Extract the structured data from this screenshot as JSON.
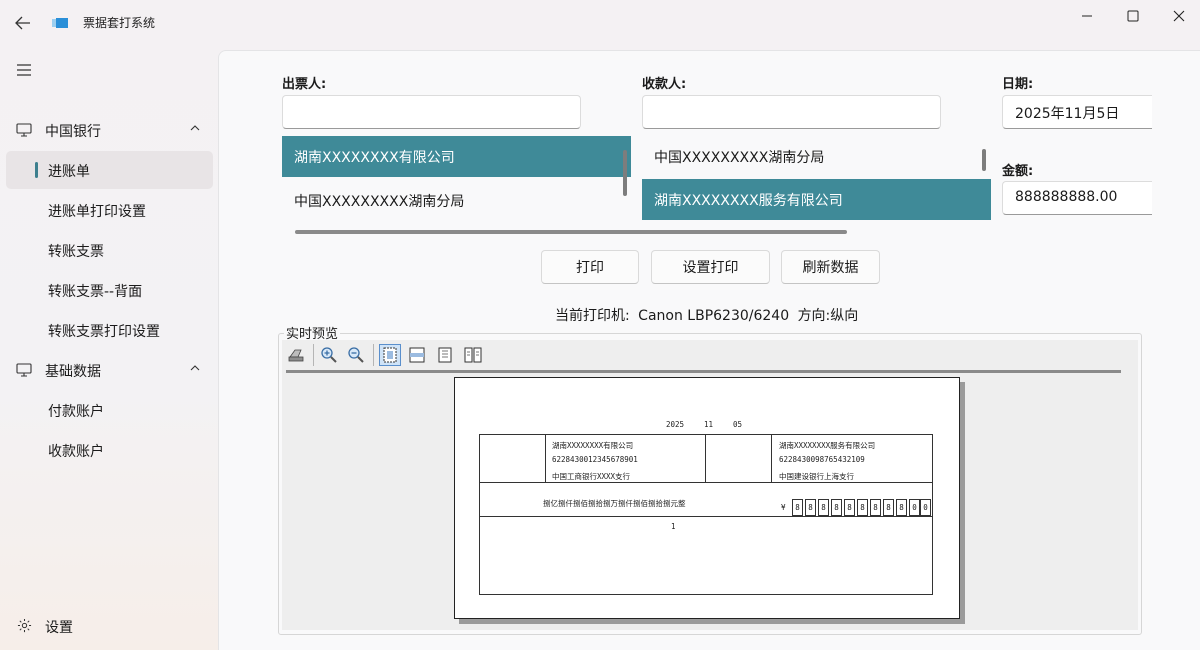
{
  "window": {
    "title": "票据套打系统",
    "logo_icon": "app-logo-icon",
    "controls": [
      "minimize-icon",
      "maximize-icon",
      "close-icon"
    ]
  },
  "nav": {
    "groups": [
      {
        "label": "中国银行",
        "icon": "monitor-icon",
        "items": [
          "进账单",
          "进账单打印设置",
          "转账支票",
          "转账支票--背面",
          "转账支票打印设置"
        ]
      },
      {
        "label": "基础数据",
        "icon": "monitor-icon",
        "items": [
          "付款账户",
          "收款账户"
        ]
      }
    ],
    "active_item": "进账单",
    "settings": {
      "label": "设置",
      "icon": "gear-icon"
    }
  },
  "form": {
    "payer": {
      "label": "出票人:",
      "value": "",
      "options": [
        "湖南XXXXXXXX有限公司",
        "中国XXXXXXXXX湖南分局"
      ],
      "selected": 0
    },
    "payee": {
      "label": "收款人:",
      "value": "",
      "options": [
        "中国XXXXXXXXX湖南分局",
        "湖南XXXXXXXX服务有限公司"
      ],
      "selected": 1
    },
    "date": {
      "label": "日期:",
      "value": "2025年11月5日"
    },
    "amount": {
      "label": "金额:",
      "value": "888888888.00"
    }
  },
  "actions": {
    "print": "打印",
    "print_setup": "设置打印",
    "refresh": "刷新数据"
  },
  "printer_status": {
    "printer_label": "当前打印机:",
    "printer_name": "Canon LBP6230/6240",
    "orientation_label": "方向:",
    "orientation": "纵向"
  },
  "preview": {
    "title": "实时预览",
    "toolbar_icons": [
      "print-icon",
      "zoom-in-icon",
      "zoom-out-icon",
      "fit-page-icon",
      "fit-width-icon",
      "single-page-icon",
      "two-pages-icon"
    ],
    "slip": {
      "year": "2025",
      "month": "11",
      "day": "05",
      "payer_name": "湖南XXXXXXXX有限公司",
      "payer_account": "6228430012345678901",
      "payer_bank": "中国工商银行XXXX支行",
      "payee_name": "湖南XXXXXXXX服务有限公司",
      "payee_account": "6228430098765432109",
      "payee_bank": "中国建设银行上海支行",
      "amount_words": "捌亿捌仟捌佰捌拾捌万捌仟捌佰捌拾捌元整",
      "currency": "¥",
      "amount_digits": [
        "8",
        "8",
        "8",
        "8",
        "8",
        "8",
        "8",
        "8",
        "8",
        "0",
        "0"
      ],
      "footer_number": "1"
    }
  }
}
